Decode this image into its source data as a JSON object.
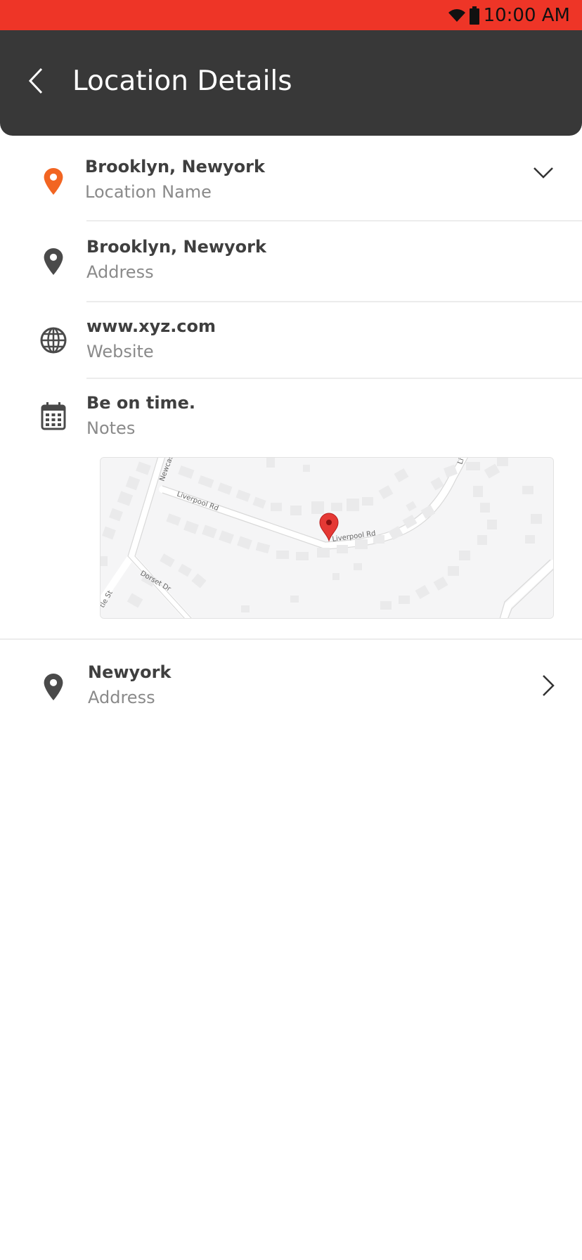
{
  "status_bar": {
    "time": "10:00 AM",
    "icons": [
      "wifi-icon",
      "battery-icon"
    ],
    "background": "#ee3527"
  },
  "header": {
    "title": "Location Details",
    "back_icon": "chevron-left-icon",
    "background": "#383838"
  },
  "location_name": {
    "value": "Brooklyn, Newyork",
    "label": "Location Name",
    "icon": "location-pin-icon",
    "icon_color": "#f26522",
    "expand_icon": "chevron-down-icon"
  },
  "address": {
    "value": "Brooklyn, Newyork",
    "label": "Address",
    "icon": "location-pin-icon"
  },
  "website": {
    "value": "www.xyz.com",
    "label": "Website",
    "icon": "globe-icon"
  },
  "notes": {
    "value": "Be on time.",
    "label": "Notes",
    "icon": "calendar-icon"
  },
  "map": {
    "marker_icon": "map-marker-icon",
    "marker_color": "#e53935",
    "street_labels": [
      "Liverpool Rd",
      "Liverpool Rd",
      "Newcas",
      "Dorset Dr",
      "tle St",
      "Li"
    ]
  },
  "second_location": {
    "value": "Newyork",
    "label": "Address",
    "icon": "location-pin-icon",
    "nav_icon": "chevron-right-icon"
  }
}
